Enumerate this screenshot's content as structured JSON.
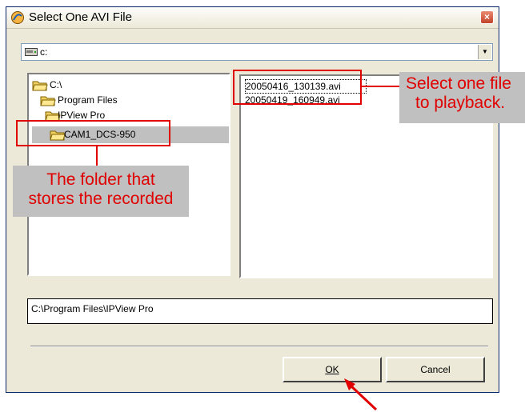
{
  "window": {
    "title": "Select One AVI File",
    "close_glyph": "×"
  },
  "drive_selector": {
    "value": "c:",
    "icon": "drive-icon",
    "arrow_glyph": "▼"
  },
  "folder_tree": {
    "items": [
      {
        "label": "C:\\",
        "selected": false
      },
      {
        "label": "Program Files",
        "selected": false
      },
      {
        "label": "IPView Pro",
        "selected": false
      },
      {
        "label": "CAM1_DCS-950",
        "selected": true
      }
    ]
  },
  "file_list": {
    "files": [
      "20050416_130139.avi",
      "20050419_160949.avi"
    ]
  },
  "current_path": "C:\\Program Files\\IPView Pro",
  "buttons": {
    "ok": "OK",
    "cancel": "Cancel"
  },
  "annotations": {
    "folder_callout": [
      "The folder that",
      "stores the recorded"
    ],
    "file_callout": [
      "Select one file",
      "to playback."
    ]
  },
  "colors": {
    "annotation_red": "#e00000",
    "callout_bg": "#c0c0c0",
    "window_bg": "#ece9d8"
  }
}
